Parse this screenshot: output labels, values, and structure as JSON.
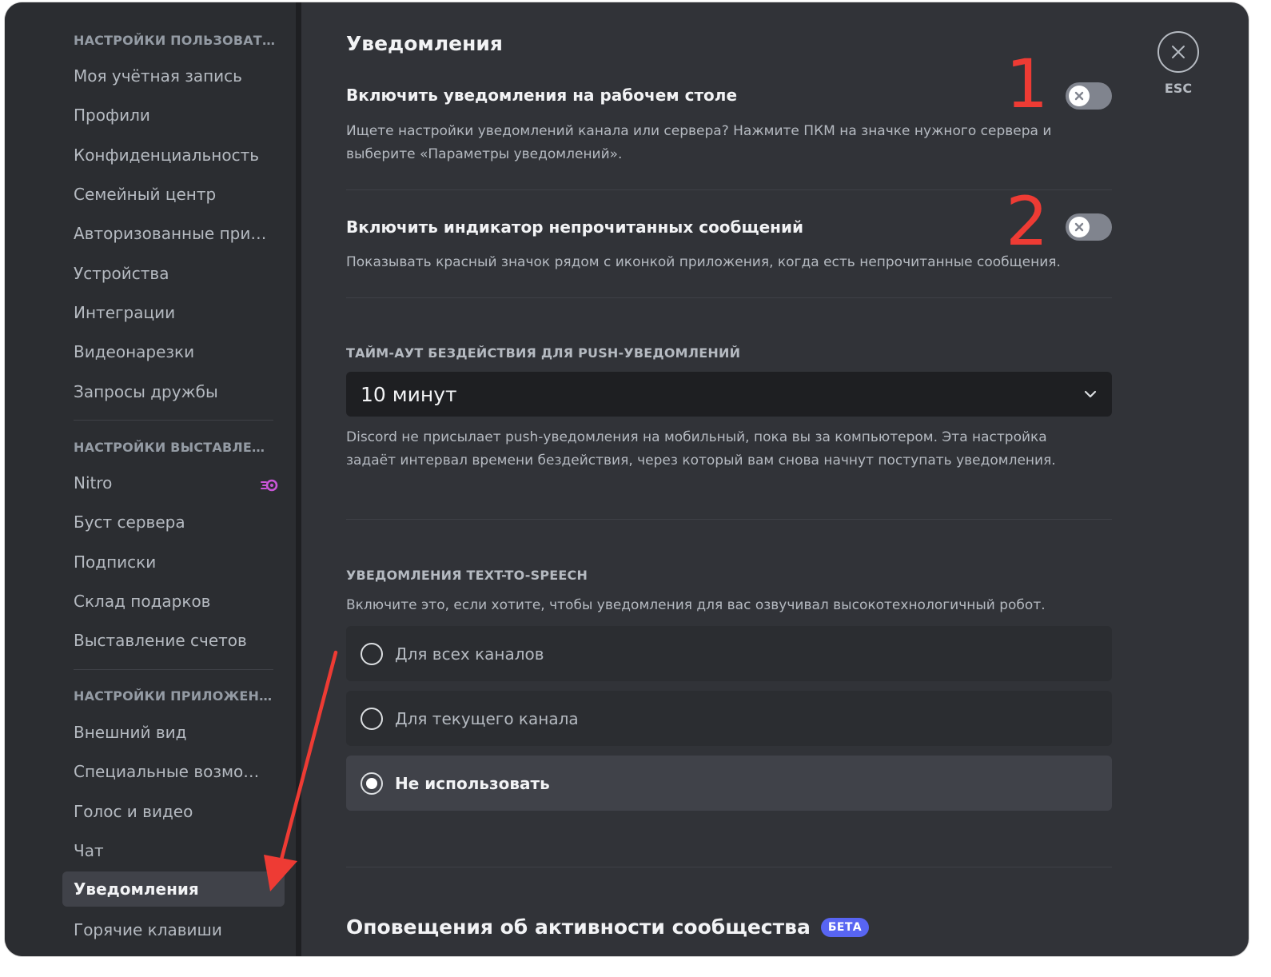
{
  "sidebar": {
    "sections": [
      {
        "header": "НАСТРОЙКИ ПОЛЬЗОВАТЕЛЯ",
        "items": [
          {
            "label": "Моя учётная запись"
          },
          {
            "label": "Профили"
          },
          {
            "label": "Конфиденциальность"
          },
          {
            "label": "Семейный центр"
          },
          {
            "label": "Авторизованные приложения"
          },
          {
            "label": "Устройства"
          },
          {
            "label": "Интеграции"
          },
          {
            "label": "Видеонарезки"
          },
          {
            "label": "Запросы дружбы"
          }
        ]
      },
      {
        "header": "НАСТРОЙКИ ВЫСТАВЛЕНИЯ СЧЕТОВ",
        "items": [
          {
            "label": "Nitro",
            "icon": "nitro-icon"
          },
          {
            "label": "Буст сервера"
          },
          {
            "label": "Подписки"
          },
          {
            "label": "Склад подарков"
          },
          {
            "label": "Выставление счетов"
          }
        ]
      },
      {
        "header": "НАСТРОЙКИ ПРИЛОЖЕНИЯ",
        "items": [
          {
            "label": "Внешний вид"
          },
          {
            "label": "Специальные возможности"
          },
          {
            "label": "Голос и видео"
          },
          {
            "label": "Чат"
          },
          {
            "label": "Уведомления",
            "active": true
          },
          {
            "label": "Горячие клавиши"
          }
        ]
      }
    ]
  },
  "main": {
    "title": "Уведомления",
    "desktop_notifications": {
      "title": "Включить уведомления на рабочем столе",
      "note": "Ищете настройки уведомлений канала или сервера? Нажмите ПКМ на значке нужного сервера и выберите «Параметры уведомлений».",
      "enabled": false
    },
    "unread_badge": {
      "title": "Включить индикатор непрочитанных сообщений",
      "note": "Показывать красный значок рядом с иконкой приложения, когда есть непрочитанные сообщения.",
      "enabled": false
    },
    "push_timeout": {
      "label": "ТАЙМ-АУТ БЕЗДЕЙСТВИЯ ДЛЯ PUSH-УВЕДОМЛЕНИЙ",
      "selected": "10 минут",
      "note": "Discord не присылает push-уведомления на мобильный, пока вы за компьютером. Эта настройка задаёт интервал времени бездействия, через который вам снова начнут поступать уведомления."
    },
    "tts": {
      "label": "УВЕДОМЛЕНИЯ TEXT-TO-SPEECH",
      "note": "Включите это, если хотите, чтобы уведомления для вас озвучивал высокотехнологичный робот.",
      "options": [
        {
          "label": "Для всех каналов",
          "checked": false
        },
        {
          "label": "Для текущего канала",
          "checked": false
        },
        {
          "label": "Не использовать",
          "checked": true
        }
      ]
    },
    "community": {
      "title": "Оповещения об активности сообщества",
      "badge": "БЕТА"
    }
  },
  "close": {
    "esc_label": "ESC"
  },
  "annotations": {
    "marker_1": "1",
    "marker_2": "2",
    "color": "#ee3b34"
  },
  "colors": {
    "sidebar_bg": "#2b2d31",
    "content_bg": "#313338",
    "toggle_off": "#80848e",
    "badge": "#5865f2"
  }
}
